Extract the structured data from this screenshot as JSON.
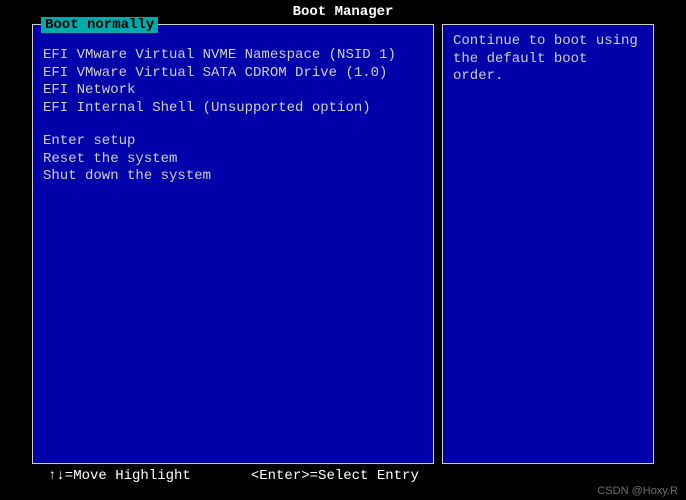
{
  "title": "Boot Manager",
  "selected": "Boot normally",
  "boot_options": [
    "EFI VMware Virtual NVME Namespace (NSID 1)",
    "EFI VMware Virtual SATA CDROM Drive (1.0)",
    "EFI Network",
    "EFI Internal Shell (Unsupported option)"
  ],
  "system_options": [
    "Enter setup",
    "Reset the system",
    "Shut down the system"
  ],
  "help": {
    "line1": "Continue to boot using",
    "line2": "the default boot order."
  },
  "footer": {
    "move": "↑↓=Move Highlight",
    "select": "<Enter>=Select Entry"
  },
  "watermark": "CSDN @Hoxy.R"
}
